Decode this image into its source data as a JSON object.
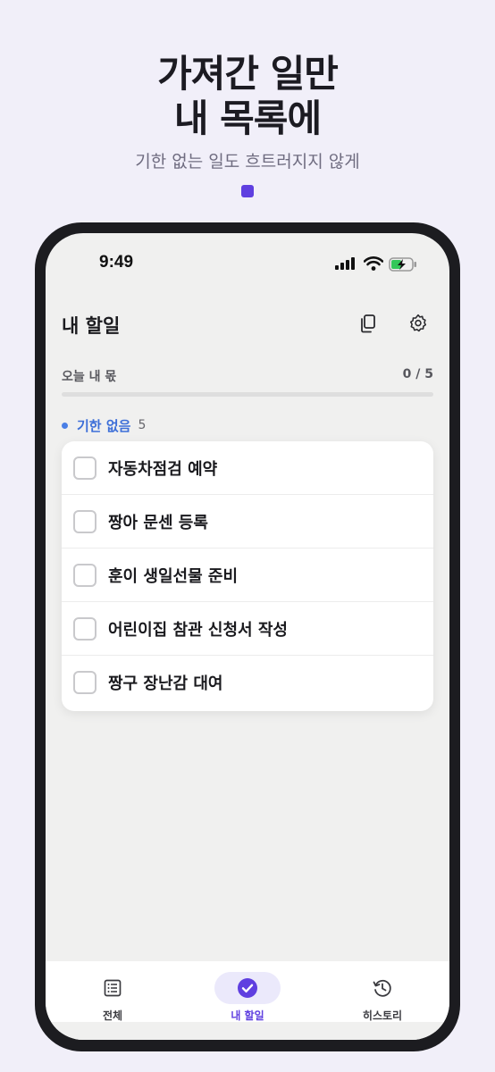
{
  "hero": {
    "title_line1": "가져간 일만",
    "title_line2": "내 목록에",
    "subtitle": "기한 없는 일도 흐트러지지 않게"
  },
  "status_bar": {
    "time": "9:49"
  },
  "header": {
    "title": "내 할일"
  },
  "progress": {
    "label": "오늘 내 몫",
    "count": "0 / 5",
    "fraction": 0
  },
  "section": {
    "label": "기한 없음",
    "count": "5"
  },
  "tasks": [
    {
      "label": "자동차점검 예약",
      "checked": false
    },
    {
      "label": "짱아 문센 등록",
      "checked": false
    },
    {
      "label": "훈이 생일선물 준비",
      "checked": false
    },
    {
      "label": "어린이집 참관 신청서 작성",
      "checked": false
    },
    {
      "label": "짱구 장난감 대여",
      "checked": false
    }
  ],
  "tabbar": {
    "items": [
      {
        "label": "전체",
        "icon": "list-icon",
        "active": false
      },
      {
        "label": "내 할일",
        "icon": "check-circle-icon",
        "active": true
      },
      {
        "label": "히스토리",
        "icon": "history-icon",
        "active": false
      }
    ]
  },
  "colors": {
    "accent": "#5f3fe0",
    "section_blue": "#3d6fd8",
    "background": "#f1eff9",
    "battery_green": "#34c759"
  }
}
